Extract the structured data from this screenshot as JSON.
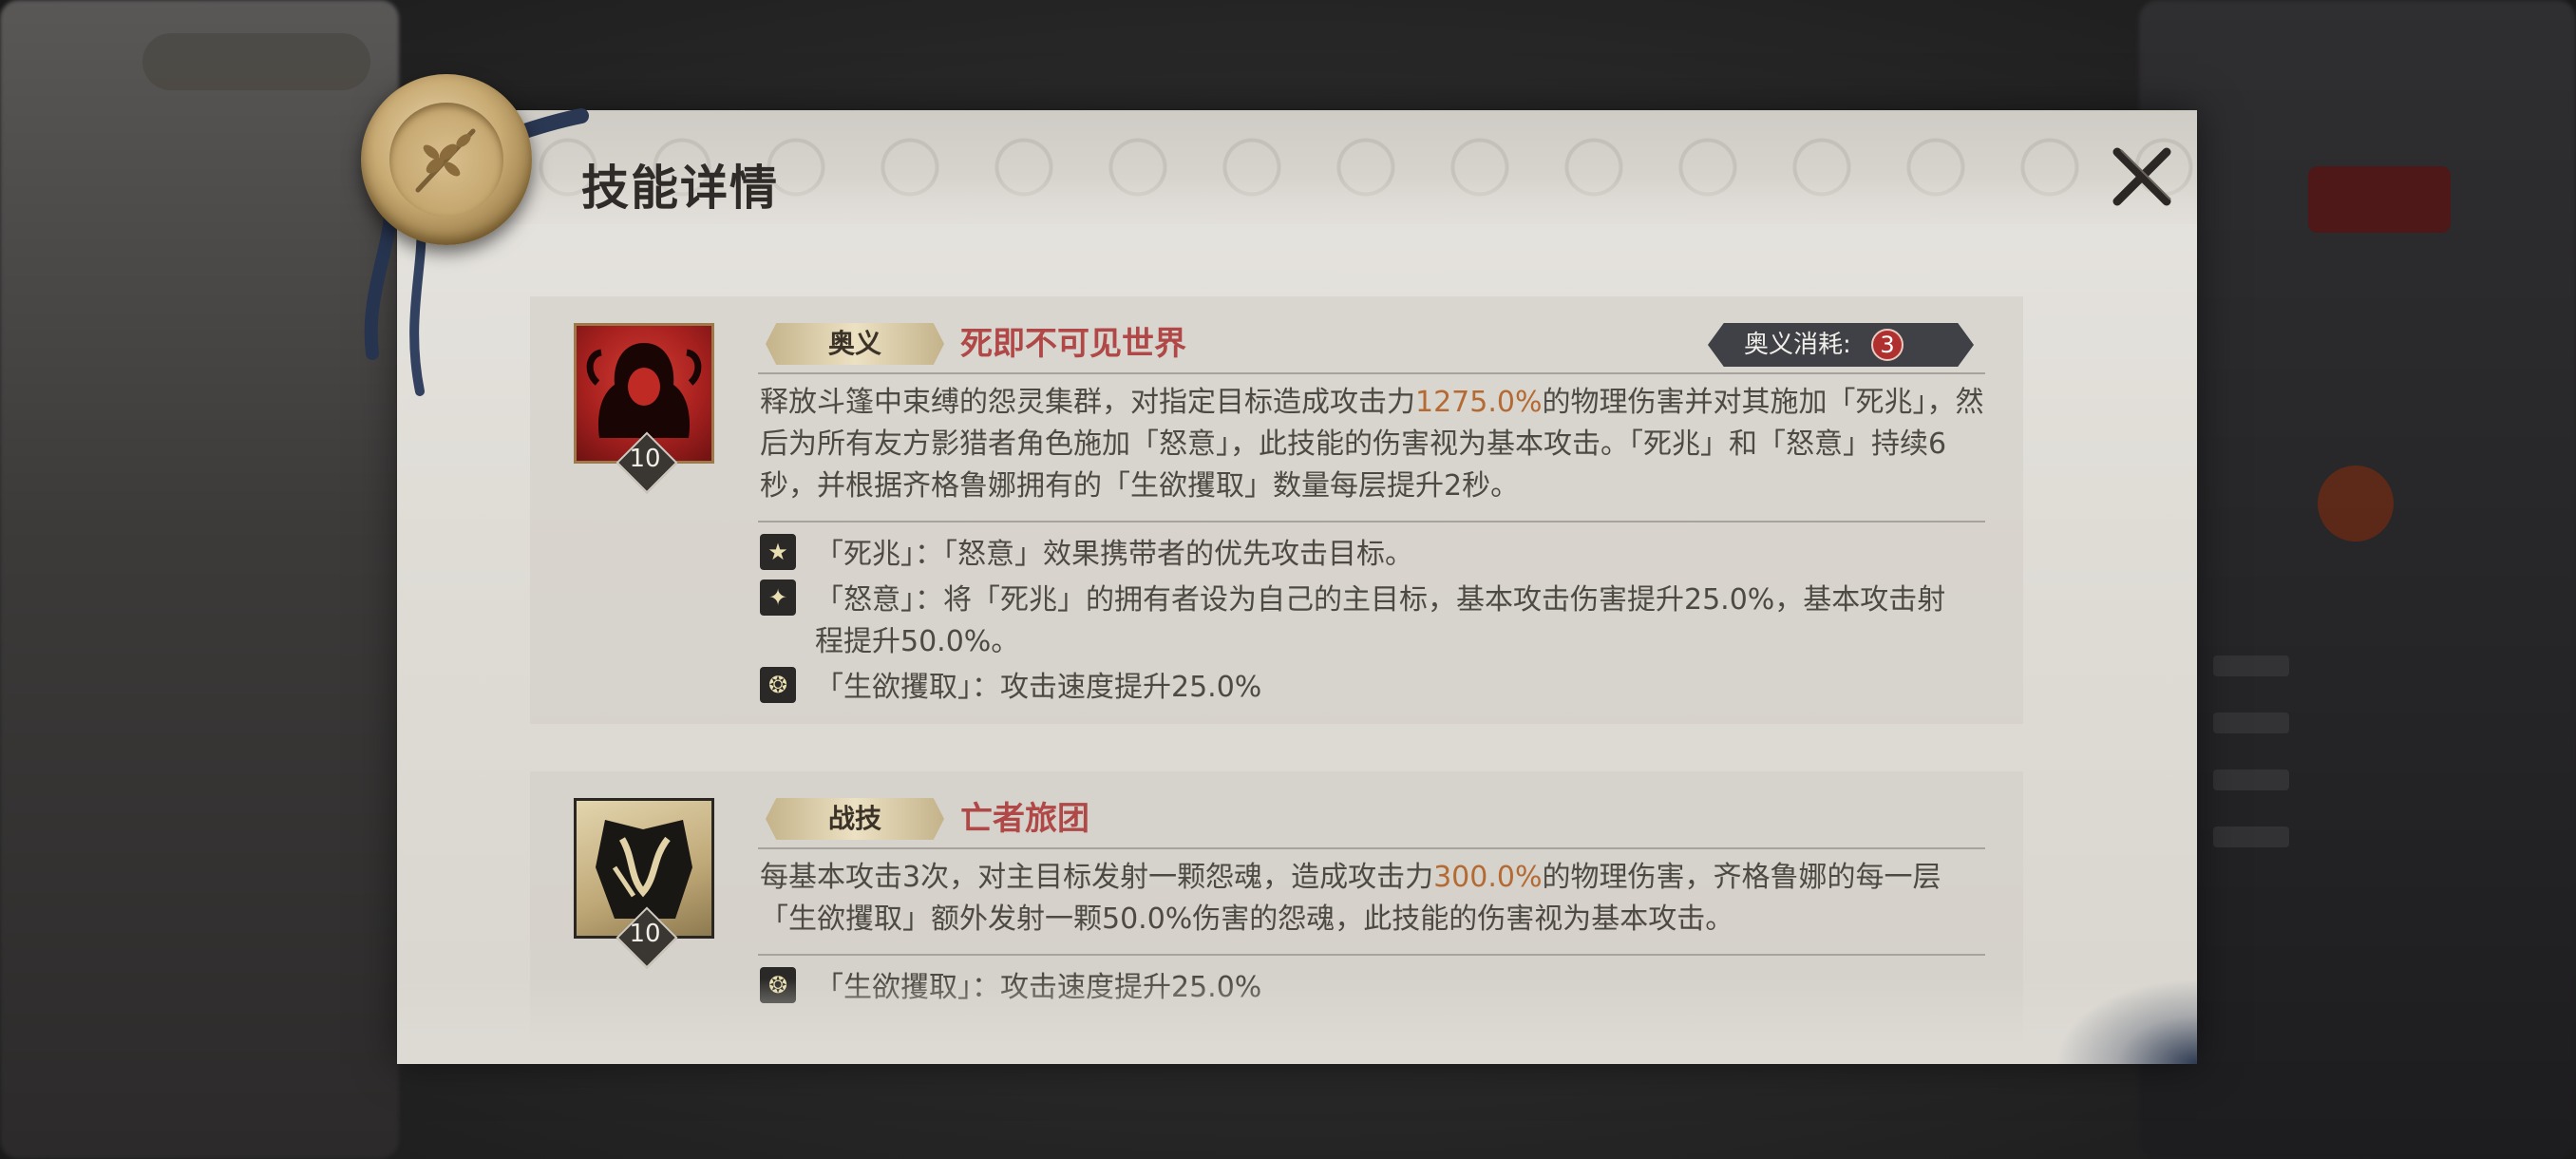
{
  "title": "技能详情",
  "skills": [
    {
      "tag": "奥义",
      "name": "死即不可见世界",
      "level": "10",
      "cost_label": "奥义消耗:",
      "cost_value": "3",
      "desc_pre": "释放斗篷中束缚的怨灵集群，对指定目标造成攻击力",
      "desc_hl": "1275.0%",
      "desc_post": "的物理伤害并对其施加「死兆」，然后为所有友方影猎者角色施加「怒意」，此技能的伤害视为基本攻击。「死兆」和「怒意」持续6秒，并根据齐格鲁娜拥有的「生欲攫取」数量每层提升2秒。",
      "effects": [
        {
          "icon": "star-effect-icon",
          "text": "「死兆」：「怒意」效果携带者的优先攻击目标。"
        },
        {
          "icon": "compass-effect-icon",
          "text": "「怒意」：将「死兆」的拥有者设为自己的主目标，基本攻击伤害提升25.0%，基本攻击射程提升50.0%。"
        },
        {
          "icon": "soul-effect-icon",
          "text": "「生欲攫取」：攻击速度提升25.0%"
        }
      ]
    },
    {
      "tag": "战技",
      "name": "亡者旅团",
      "level": "10",
      "desc_pre": "每基本攻击3次，对主目标发射一颗怨魂，造成攻击力",
      "desc_hl": "300.0%",
      "desc_post": "的物理伤害，齐格鲁娜的每一层「生欲攫取」额外发射一颗50.0%伤害的怨魂，此技能的伤害视为基本攻击。",
      "effects": [
        {
          "icon": "soul-effect-icon",
          "text": "「生欲攫取」：攻击速度提升25.0%"
        }
      ]
    }
  ],
  "colors": {
    "accent_name": "#b04848",
    "highlight": "#b46a32",
    "cost_bubble": "#b03030"
  }
}
